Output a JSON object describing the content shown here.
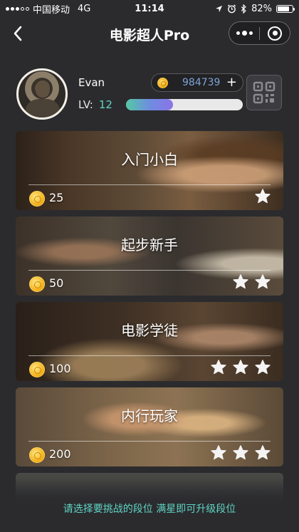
{
  "status": {
    "carrier": "中国移动",
    "network": "4G",
    "time": "11:14",
    "battery": "82%",
    "battery_level": 0.82
  },
  "nav": {
    "title": "电影超人Pro",
    "back_icon": "chevron-left-icon",
    "more_icon": "more-dots-icon",
    "close_icon": "target-circle-icon"
  },
  "profile": {
    "name": "Evan",
    "lv_label": "LV:",
    "lv_value": "12",
    "coins": "984739",
    "add_label": "+",
    "exp_progress": 0.4,
    "qr_icon": "qr-code-icon"
  },
  "levels": [
    {
      "title": "入门小白",
      "cost": "25",
      "stars": 1
    },
    {
      "title": "起步新手",
      "cost": "50",
      "stars": 2
    },
    {
      "title": "电影学徒",
      "cost": "100",
      "stars": 3
    },
    {
      "title": "内行玩家",
      "cost": "200",
      "stars": 3
    }
  ],
  "hint": "请选择要挑战的段位 满星即可升级段位",
  "colors": {
    "background": "#2b2b2e",
    "accent_teal": "#5fd4c4",
    "coin_gold": "#f4b01a",
    "coin_amount": "#7ea3d6"
  }
}
